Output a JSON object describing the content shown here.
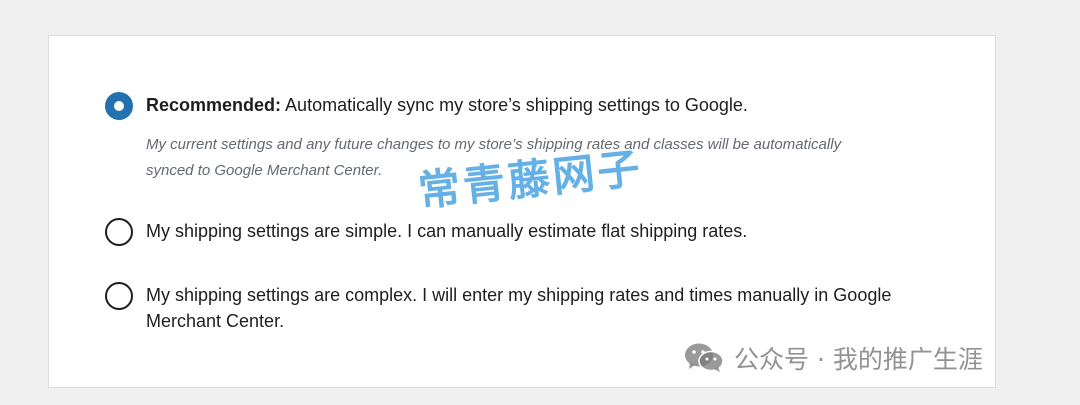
{
  "shipping_options": [
    {
      "title": "Recommended:",
      "label": "Automatically sync my store’s shipping settings to Google.",
      "help": "My current settings and any future changes to my store’s shipping rates and classes will be automatically synced to Google Merchant Center.",
      "checked": true
    },
    {
      "label": "My shipping settings are simple. I can manually estimate flat shipping rates.",
      "checked": false
    },
    {
      "label": "My shipping settings are complex. I will enter my shipping rates and times manually in Google Merchant Center.",
      "checked": false
    }
  ],
  "watermarks": {
    "center_text": "常青藤网子",
    "corner_text": "公众号 · 我的推广生涯",
    "corner_icon": "wechat-icon"
  },
  "colors": {
    "accent": "#2271b1",
    "help_text": "#646970",
    "watermark_blue": "#4aa3e1"
  }
}
